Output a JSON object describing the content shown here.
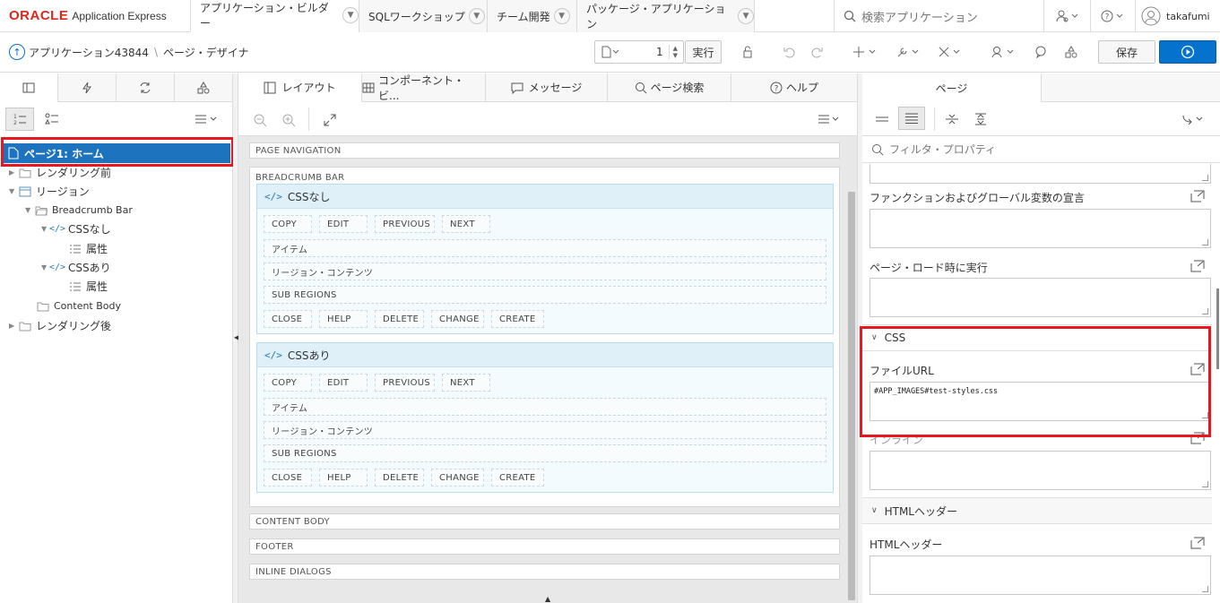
{
  "header": {
    "logo_brand": "ORACLE",
    "logo_product": "Application Express",
    "tabs": [
      {
        "label": "アプリケーション・ビルダー"
      },
      {
        "label": "SQLワークショップ"
      },
      {
        "label": "チーム開発"
      },
      {
        "label": "パッケージ・アプリケーション"
      }
    ],
    "search_placeholder": "検索アプリケーション",
    "user_name": "takafumi"
  },
  "toolbar": {
    "breadcrumb_app": "アプリケーション43844",
    "breadcrumb_page": "ページ・デザイナ",
    "page_number": "1",
    "run_label": "実行",
    "save_label": "保存"
  },
  "left": {
    "tree": [
      {
        "label": "ページ1: ホーム"
      },
      {
        "label": "レンダリング前"
      },
      {
        "label": "リージョン"
      },
      {
        "label": "Breadcrumb Bar"
      },
      {
        "label": "CSSなし"
      },
      {
        "label": "属性"
      },
      {
        "label": "CSSあり"
      },
      {
        "label": "属性"
      },
      {
        "label": "Content Body"
      },
      {
        "label": "レンダリング後"
      }
    ]
  },
  "middle": {
    "tabs": [
      {
        "label": "レイアウト"
      },
      {
        "label": "コンポーネント・ビ..."
      },
      {
        "label": "メッセージ"
      },
      {
        "label": "ページ検索"
      },
      {
        "label": "ヘルプ"
      }
    ],
    "strips": {
      "page_navigation": "PAGE NAVIGATION",
      "breadcrumb_bar": "BREADCRUMB BAR",
      "content_body": "CONTENT BODY",
      "footer": "FOOTER",
      "inline_dialogs": "INLINE DIALOGS"
    },
    "regions": [
      {
        "title": "CSSなし",
        "top_buttons": [
          "COPY",
          "EDIT",
          "PREVIOUS",
          "NEXT"
        ],
        "items": "アイテム",
        "region_content": "リージョン・コンテンツ",
        "sub_regions": "SUB REGIONS",
        "bottom_buttons": [
          "CLOSE",
          "HELP",
          "DELETE",
          "CHANGE",
          "CREATE"
        ]
      },
      {
        "title": "CSSあり",
        "top_buttons": [
          "COPY",
          "EDIT",
          "PREVIOUS",
          "NEXT"
        ],
        "items": "アイテム",
        "region_content": "リージョン・コンテンツ",
        "sub_regions": "SUB REGIONS",
        "bottom_buttons": [
          "CLOSE",
          "HELP",
          "DELETE",
          "CHANGE",
          "CREATE"
        ]
      }
    ]
  },
  "right": {
    "tab_label": "ページ",
    "filter_placeholder": "フィルタ・プロパティ",
    "props": {
      "function_decl": "ファンクションおよびグローバル変数の宣言",
      "on_load": "ページ・ロード時に実行",
      "css_section": "CSS",
      "file_url": "ファイルURL",
      "file_url_value": "#APP_IMAGES#test-styles.css",
      "inline": "インライン",
      "html_header_section": "HTMLヘッダー",
      "html_header": "HTMLヘッダー"
    }
  },
  "colors": {
    "oracle_red": "#e1251b",
    "apex_blue": "#0572ce",
    "selected_row": "#1e73be",
    "highlight_red": "#e8171f"
  }
}
